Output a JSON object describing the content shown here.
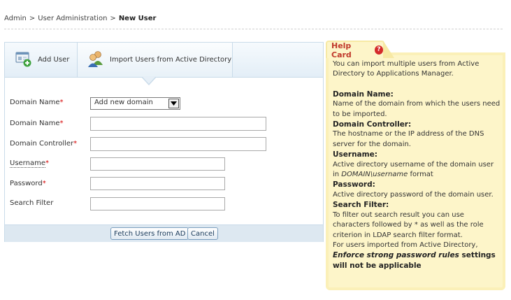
{
  "breadcrumb": {
    "item1": "Admin",
    "sep": ">",
    "item2": "User Administration",
    "item3": "New User"
  },
  "tabs": {
    "add_user": "Add User",
    "import_ad": "Import Users from Active Directory"
  },
  "form": {
    "domain_select_label": "Domain Name",
    "domain_select_value": "Add new domain",
    "domain_name_label": "Domain Name",
    "domain_controller_label": "Domain Controller",
    "username_label": "Username",
    "password_label": "Password",
    "search_filter_label": "Search Filter",
    "required_mark": "*"
  },
  "buttons": {
    "fetch": "Fetch Users from AD",
    "cancel": "Cancel"
  },
  "help": {
    "title": "Help Card",
    "intro": "You can import multiple users from Active Directory to Applications Manager.",
    "domain_name_h": "Domain Name:",
    "domain_name_t": "Name of the domain from which the users need to be imported.",
    "domain_controller_h": "Domain Controller:",
    "domain_controller_t": "The hostname or the IP address of the DNS server for the domain.",
    "username_h": "Username:",
    "username_t1": "Active directory username of the domain user in ",
    "username_t2": "DOMAIN\\username",
    "username_t3": " format",
    "password_h": "Password:",
    "password_t": "Active directory password of the domain user.",
    "search_h": "Search Filter:",
    "search_t": "To filter out search result you can use characters followed by * as well as the role criterion in LDAP search filter format.",
    "note1": "For users imported from Active Directory,",
    "note2": "Enforce strong password rules",
    "note3": " settings will not be applicable"
  },
  "colors": {
    "required": "#d60000",
    "help_title": "#c0392b",
    "help_bg": "#fdf5c9"
  }
}
